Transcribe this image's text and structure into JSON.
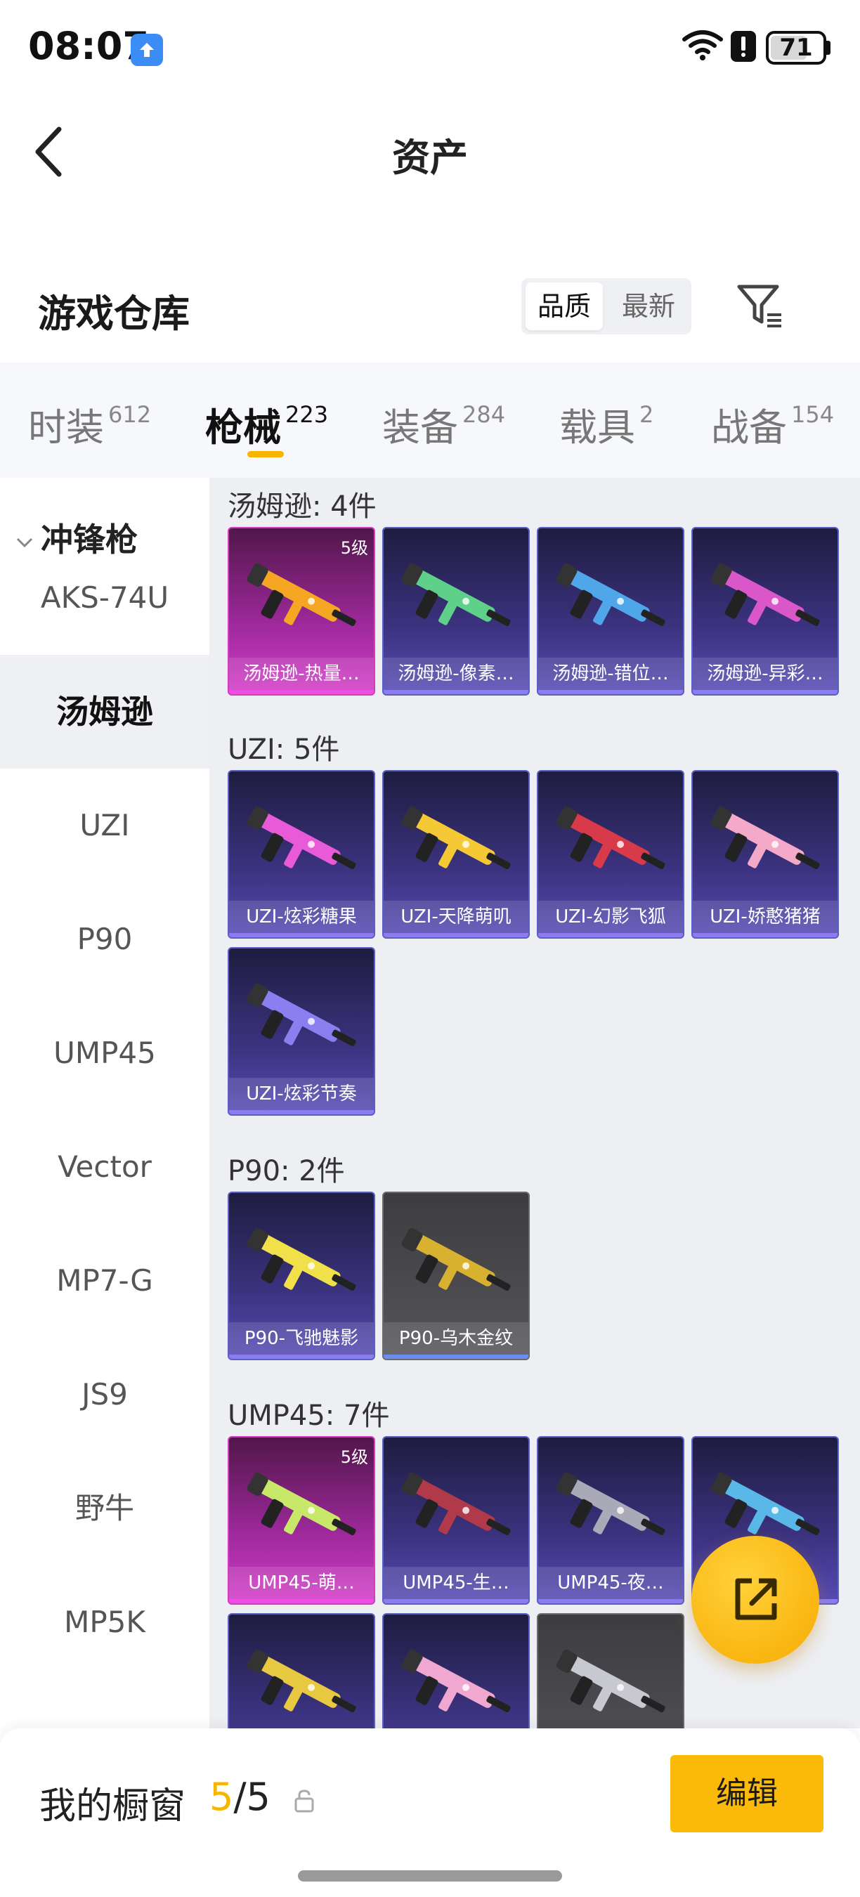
{
  "status_bar": {
    "time": "08:07",
    "battery": "71",
    "battery_level": 0.71
  },
  "header": {
    "title": "资产"
  },
  "warehouse": {
    "title": "游戏仓库",
    "sort_options": [
      "品质",
      "最新"
    ],
    "sort_selected": "品质"
  },
  "tabs": [
    {
      "label": "时装",
      "count": "612"
    },
    {
      "label": "枪械",
      "count": "223"
    },
    {
      "label": "装备",
      "count": "284"
    },
    {
      "label": "载具",
      "count": "2"
    },
    {
      "label": "战备",
      "count": "154"
    }
  ],
  "active_tab": "枪械",
  "side": {
    "group": "冲锋枪",
    "items": [
      "AKS-74U",
      "汤姆逊",
      "UZI",
      "P90",
      "UMP45",
      "Vector",
      "MP7-G",
      "JS9",
      "野牛",
      "MP5K"
    ],
    "active": "汤姆逊"
  },
  "sections": [
    {
      "title": "汤姆逊: 4件",
      "items": [
        {
          "label": "汤姆逊-热量…",
          "rarity": "pink",
          "level": "5级",
          "gun_color": "#f5a623"
        },
        {
          "label": "汤姆逊-像素…",
          "rarity": "purple",
          "level": "",
          "gun_color": "#5fd08a"
        },
        {
          "label": "汤姆逊-错位…",
          "rarity": "purple",
          "level": "",
          "gun_color": "#4fa6e8"
        },
        {
          "label": "汤姆逊-异彩…",
          "rarity": "purple",
          "level": "",
          "gun_color": "#d957c8"
        }
      ]
    },
    {
      "title": "UZI: 5件",
      "items": [
        {
          "label": "UZI-炫彩糖果",
          "rarity": "purple",
          "level": "",
          "gun_color": "#e85ad8"
        },
        {
          "label": "UZI-天降萌叽",
          "rarity": "purple",
          "level": "",
          "gun_color": "#f5c935"
        },
        {
          "label": "UZI-幻影飞狐",
          "rarity": "purple",
          "level": "",
          "gun_color": "#d93a4a"
        },
        {
          "label": "UZI-娇憨猪猪",
          "rarity": "purple",
          "level": "",
          "gun_color": "#f4a9c8"
        },
        {
          "label": "UZI-炫彩节奏",
          "rarity": "purple",
          "level": "",
          "gun_color": "#8a7ff0"
        }
      ]
    },
    {
      "title": "P90: 2件",
      "items": [
        {
          "label": "P90-飞驰魅影",
          "rarity": "purple",
          "level": "",
          "gun_color": "#f2e04a"
        },
        {
          "label": "P90-乌木金纹",
          "rarity": "gray",
          "level": "",
          "gun_color": "#d9b130"
        }
      ]
    },
    {
      "title": "UMP45: 7件",
      "items": [
        {
          "label": "UMP45-萌…",
          "rarity": "pink",
          "level": "5级",
          "gun_color": "#c8e86a"
        },
        {
          "label": "UMP45-生…",
          "rarity": "purple",
          "level": "",
          "gun_color": "#b03a4a"
        },
        {
          "label": "UMP45-夜…",
          "rarity": "purple",
          "level": "",
          "gun_color": "#a9a9b8"
        },
        {
          "label": "",
          "rarity": "purple",
          "level": "",
          "gun_color": "#5ab8e8"
        },
        {
          "label": "",
          "rarity": "purple",
          "level": "",
          "gun_color": "#e8c840"
        },
        {
          "label": "",
          "rarity": "purple",
          "level": "",
          "gun_color": "#f0a8d0"
        },
        {
          "label": "",
          "rarity": "gray",
          "level": "",
          "gun_color": "#c8c8d0"
        }
      ]
    }
  ],
  "bottom": {
    "title": "我的橱窗",
    "count_current": "5",
    "count_total": "/5",
    "edit_label": "编辑"
  }
}
